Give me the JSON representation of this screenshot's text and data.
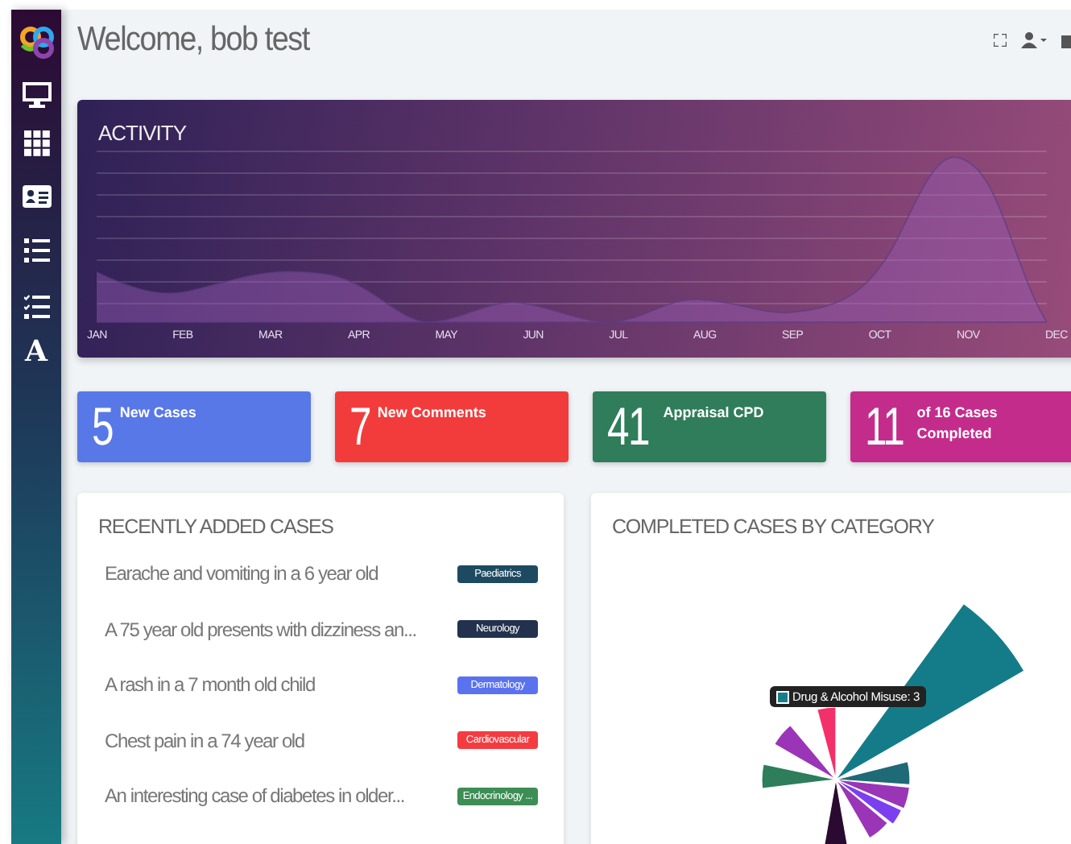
{
  "sidebar": {
    "letter_item": "A"
  },
  "header": {
    "title": "Welcome, bob test"
  },
  "activity": {
    "title": "ACTIVITY",
    "months": [
      "JAN",
      "FEB",
      "MAR",
      "APR",
      "MAY",
      "JUN",
      "JUL",
      "AUG",
      "SEP",
      "OCT",
      "NOV",
      "DEC"
    ]
  },
  "stats": [
    {
      "value": "5",
      "label": "New Cases",
      "color": "#5878e8"
    },
    {
      "value": "7",
      "label": "New Comments",
      "color": "#f23c3c"
    },
    {
      "value": "41",
      "label": "Appraisal CPD",
      "color": "#2f7d5a"
    },
    {
      "value": "11",
      "label": "of 16 Cases Completed",
      "color": "#c42c8c"
    }
  ],
  "recent_cases": {
    "title": "RECENTLY ADDED CASES",
    "rows": [
      {
        "text": "Earache and vomiting in a 6 year old",
        "tag": "Paediatrics",
        "color": "#1d4a60"
      },
      {
        "text": "A 75 year old presents with dizziness an...",
        "tag": "Neurology",
        "color": "#22324e"
      },
      {
        "text": "A rash in a 7 month old child",
        "tag": "Dermatology",
        "color": "#5a72f0"
      },
      {
        "text": "Chest pain in a 74 year old",
        "tag": "Cardiovascular",
        "color": "#f43c40"
      },
      {
        "text": "An interesting case of diabetes in older...",
        "tag": "Endocrinology ...",
        "color": "#3c8e54"
      }
    ]
  },
  "completed_by_category": {
    "title": "COMPLETED CASES BY CATEGORY",
    "tooltip": {
      "text": "Drug & Alcohol Misuse: 3",
      "color": "#15808a"
    }
  }
}
